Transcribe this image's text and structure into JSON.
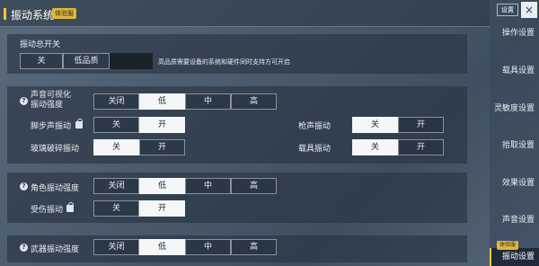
{
  "header": {
    "title": "振动系统",
    "badge": "体验服"
  },
  "sidebar": {
    "settings_chip": "设置",
    "close": "×",
    "items": [
      {
        "label": "操作设置"
      },
      {
        "label": "载具设置"
      },
      {
        "label": "灵敏度设置"
      },
      {
        "label": "拾取设置"
      },
      {
        "label": "效果设置"
      },
      {
        "label": "声音设置"
      },
      {
        "label": "振动设置"
      }
    ],
    "active_badge": "体验服"
  },
  "master": {
    "title": "振动总开关",
    "options": [
      "关",
      "低品质",
      ""
    ],
    "note": "高品质需要设备的系统和硬件同时支持方可开启"
  },
  "sound_visual": {
    "label_line1": "声音可视化",
    "label_line2": "振动强度",
    "options": [
      "关闭",
      "低",
      "中",
      "高"
    ],
    "footstep_label": "脚步声振动",
    "gunshot_label": "枪声振动",
    "glass_label": "玻璃破碎振动",
    "vehicle_label": "载具振动",
    "toggle": [
      "关",
      "开"
    ]
  },
  "character": {
    "label": "角色振动强度",
    "options": [
      "关闭",
      "低",
      "中",
      "高"
    ],
    "hurt_label": "受伤振动",
    "toggle": [
      "关",
      "开"
    ]
  },
  "weapon": {
    "label": "武器振动强度",
    "options": [
      "关闭",
      "低",
      "中",
      "高"
    ]
  }
}
